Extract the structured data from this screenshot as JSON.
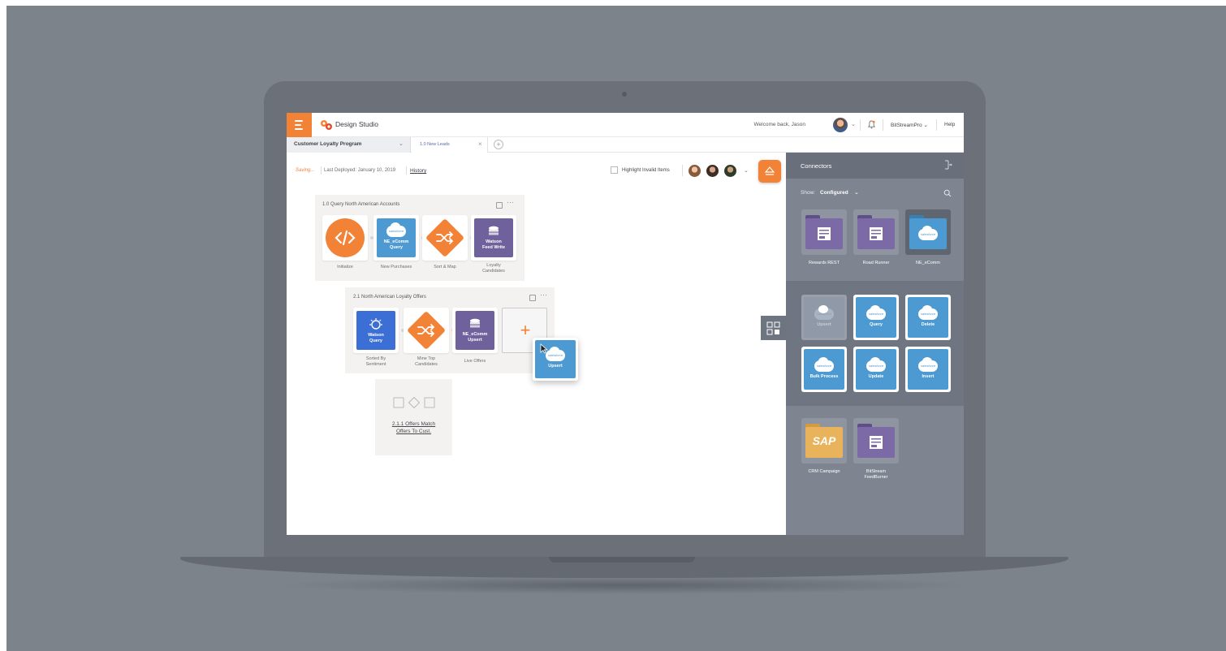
{
  "app": {
    "title": "Design Studio",
    "welcome": "Welcome back, Jason",
    "account": "BitStreamPro",
    "account_chevron": "⌄",
    "help": "Help"
  },
  "tabs": {
    "project": "Customer Loyalty Program",
    "active_tab": "1.0 New Leads",
    "close": "×",
    "add": "+"
  },
  "toolbar": {
    "saving": "Saving...",
    "last_deployed": "Last Deployed: January 10, 2019",
    "history": "History",
    "highlight_label": "Highlight Invalid Items",
    "collab_chevron": "⌄"
  },
  "groups": [
    {
      "title": "1.0 Query North American Accounts",
      "steps": [
        {
          "label": "Initialize",
          "icon": "code-icon",
          "tile_text": ""
        },
        {
          "label": "New Purchases",
          "icon": "salesforce-icon",
          "tile_text": "NE_eComm\nQuery"
        },
        {
          "label": "Sort & Map",
          "icon": "shuffle-icon",
          "tile_text": ""
        },
        {
          "label": "Loyalty\nCandidates",
          "icon": "database-icon",
          "tile_text": "Watson\nFeed Write"
        }
      ]
    },
    {
      "title": "2.1 North American Loyalty Offers",
      "steps": [
        {
          "label": "Sorted By\nSentiment",
          "icon": "watson-icon",
          "tile_text": "Watson\nQuery"
        },
        {
          "label": "Mine Top\nCandidates",
          "icon": "shuffle-icon",
          "tile_text": ""
        },
        {
          "label": "Live Offers",
          "icon": "database-icon",
          "tile_text": "NE_eComm\nUpsert"
        }
      ]
    }
  ],
  "add_step": "+",
  "drag_tile": {
    "label": "Upsert",
    "cloud": "salesforce"
  },
  "placeholder": {
    "label": "2.1.1 Offers Match\nOffers To Cust."
  },
  "panel": {
    "title": "Connectors",
    "show_label": "Show:",
    "show_value": "Configured",
    "show_chevron": "⌄",
    "connectors": [
      {
        "label": "Rewards REST",
        "icon": "folder-api-icon",
        "color": "#7b6aa6"
      },
      {
        "label": "Road Runner",
        "icon": "folder-api-icon",
        "color": "#7b6aa6"
      },
      {
        "label": "NE_eComm",
        "icon": "folder-salesforce-icon",
        "color": "#4c9ad1"
      }
    ],
    "actions": [
      {
        "label": "Upsert",
        "state": "disabled"
      },
      {
        "label": "Query",
        "state": "enabled"
      },
      {
        "label": "Delete",
        "state": "enabled"
      },
      {
        "label": "Bulk Process",
        "state": "enabled"
      },
      {
        "label": "Update",
        "state": "enabled"
      },
      {
        "label": "Insert",
        "state": "enabled"
      }
    ],
    "connectors2": [
      {
        "label": "CRM Campaign",
        "icon": "folder-sap-icon",
        "color": "#e8b35a",
        "logo": "SAP"
      },
      {
        "label": "BitStream\nFeedBurner",
        "icon": "folder-api-icon",
        "color": "#7b6aa6"
      }
    ]
  },
  "colors": {
    "accent": "#f28236",
    "salesforce": "#4c9ad1",
    "watson": "#3c6fd6",
    "purple": "#7b6aa6",
    "panel": "#7e8590"
  }
}
